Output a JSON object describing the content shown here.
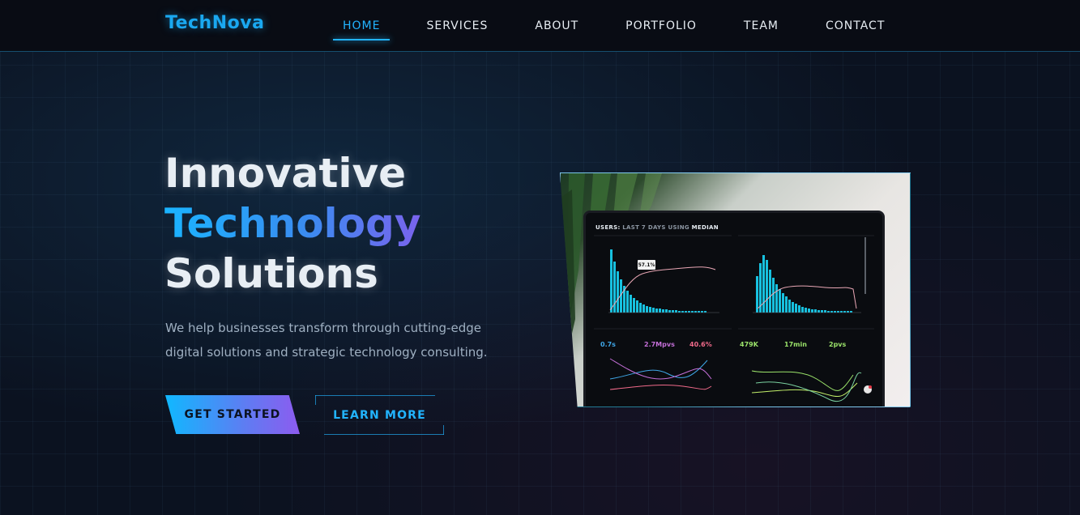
{
  "brand": {
    "name": "TechNova"
  },
  "nav": {
    "items": [
      {
        "label": "HOME",
        "active": true
      },
      {
        "label": "SERVICES",
        "active": false
      },
      {
        "label": "ABOUT",
        "active": false
      },
      {
        "label": "PORTFOLIO",
        "active": false
      },
      {
        "label": "TEAM",
        "active": false
      },
      {
        "label": "CONTACT",
        "active": false
      }
    ]
  },
  "hero": {
    "title_line1": "Innovative",
    "title_line2": "Technology",
    "title_line3": "Solutions",
    "subtitle": "We help businesses transform through cutting-edge digital solutions and strategic technology consulting.",
    "primary_button": "GET STARTED",
    "secondary_button": "LEARN MORE"
  },
  "dashboard": {
    "header_users": "USERS:",
    "header_range": "LAST 7 DAYS",
    "header_using": "USING",
    "header_median": "MEDIAN",
    "tooltip_value": "57.1%",
    "metrics": [
      {
        "value": "0.7s",
        "color": "#3fa7e8"
      },
      {
        "value": "2.7Mpvs",
        "color": "#c46fd8"
      },
      {
        "value": "40.6%",
        "color": "#f06a8a"
      },
      {
        "value": "479K",
        "color": "#9be36a"
      },
      {
        "value": "17min",
        "color": "#9be36a"
      },
      {
        "value": "2pvs",
        "color": "#9be36a"
      }
    ]
  },
  "colors": {
    "accent": "#22b4ff",
    "gradient_end": "#8d5bef",
    "background": "#0b1220"
  }
}
